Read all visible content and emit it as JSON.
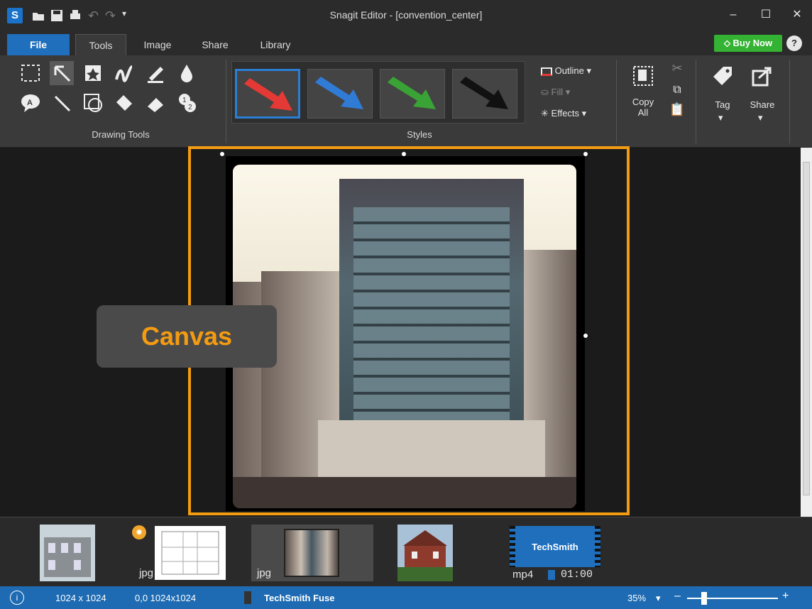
{
  "window": {
    "title": "Snagit Editor - [convention_center]",
    "logo": "S"
  },
  "menu": {
    "file": "File",
    "tools": "Tools",
    "image": "Image",
    "share": "Share",
    "library": "Library",
    "buy_now": "Buy Now",
    "help": "?"
  },
  "ribbon": {
    "drawing_tools_label": "Drawing Tools",
    "styles_label": "Styles",
    "outline": "Outline",
    "fill": "Fill",
    "effects": "Effects",
    "copy_all": "Copy All",
    "tag": "Tag",
    "share": "Share",
    "style_colors": [
      "#e53935",
      "#2f7bd6",
      "#3aa335",
      "#111111"
    ]
  },
  "canvas": {
    "callout": "Canvas"
  },
  "tray": {
    "items": [
      {
        "badge": ""
      },
      {
        "badge": "jpg"
      },
      {
        "badge": "jpg"
      },
      {
        "badge": ""
      },
      {
        "badge": "mp4",
        "duration": "01:00",
        "brand": "TechSmith"
      }
    ]
  },
  "status": {
    "info_icon": "i",
    "dimensions": "1024 x 1024",
    "position": "0,0 1024x1024",
    "fuse": "TechSmith Fuse",
    "zoom": "35%"
  },
  "colors": {
    "accent": "#f39c12",
    "file_tab": "#1f6fbd",
    "buy": "#34b233",
    "status": "#1e6bb3"
  }
}
